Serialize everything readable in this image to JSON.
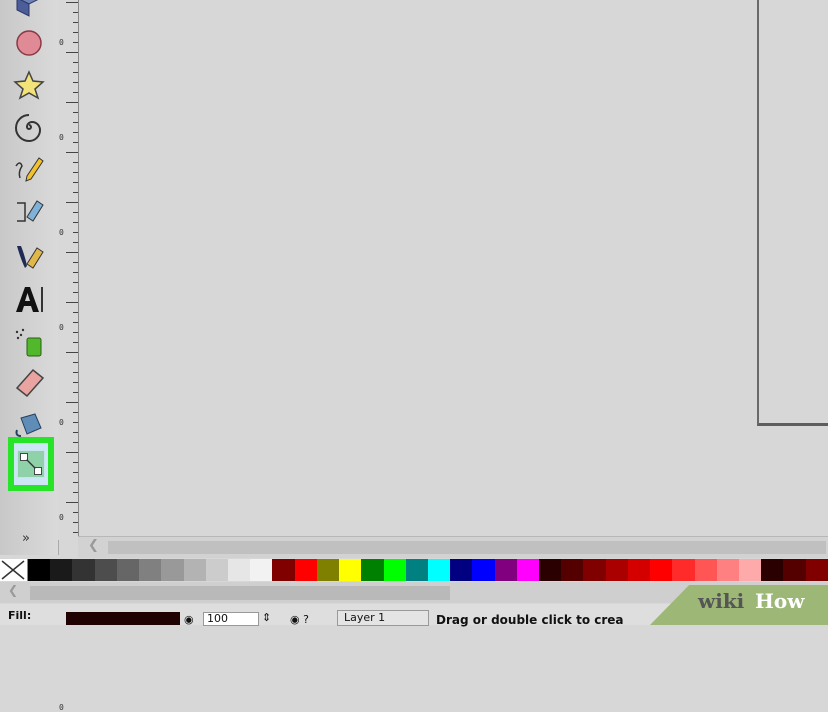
{
  "toolbox": {
    "tools": [
      {
        "name": "3d-box-tool",
        "icon": "3d-box-icon"
      },
      {
        "name": "circle-tool",
        "icon": "circle-icon"
      },
      {
        "name": "star-tool",
        "icon": "star-icon"
      },
      {
        "name": "spiral-tool",
        "icon": "spiral-icon"
      },
      {
        "name": "pencil-tool",
        "icon": "pencil-icon"
      },
      {
        "name": "pen-tool",
        "icon": "pen-icon"
      },
      {
        "name": "calligraphy-tool",
        "icon": "calligraphy-icon"
      },
      {
        "name": "text-tool",
        "icon": "text-icon"
      },
      {
        "name": "spray-tool",
        "icon": "spray-icon"
      },
      {
        "name": "eraser-tool",
        "icon": "eraser-icon"
      },
      {
        "name": "paint-bucket-tool",
        "icon": "paint-bucket-icon"
      },
      {
        "name": "connector-tool",
        "icon": "connector-icon",
        "selected": true
      }
    ],
    "expand_label": "»",
    "highlight_color": "#28e428"
  },
  "ruler": {
    "labels": [
      "0",
      "0",
      "0",
      "0",
      "0",
      "0",
      "0",
      "0"
    ]
  },
  "palette": {
    "none_icon": "none-color-icon",
    "swatches": [
      "#000000",
      "#1a1a1a",
      "#333333",
      "#4d4d4d",
      "#666666",
      "#808080",
      "#999999",
      "#b3b3b3",
      "#cccccc",
      "#e6e6e6",
      "#f2f2f2",
      "#800000",
      "#ff0000",
      "#808000",
      "#ffff00",
      "#008000",
      "#00ff00",
      "#008080",
      "#00ffff",
      "#000080",
      "#0000ff",
      "#800080",
      "#ff00ff",
      "#2b0000",
      "#550000",
      "#800000",
      "#aa0000",
      "#d40000",
      "#ff0000",
      "#ff2a2a",
      "#ff5555",
      "#ff8080",
      "#ffaaaa",
      "#2b0000",
      "#550000",
      "#800000"
    ]
  },
  "status": {
    "fill_label": "Fill:",
    "fill_color": "#200202",
    "opacity_value": "100",
    "layer_name": "Layer 1",
    "message": "Drag or double click to crea"
  },
  "watermark": {
    "wiki": "wiki",
    "how": "How"
  }
}
